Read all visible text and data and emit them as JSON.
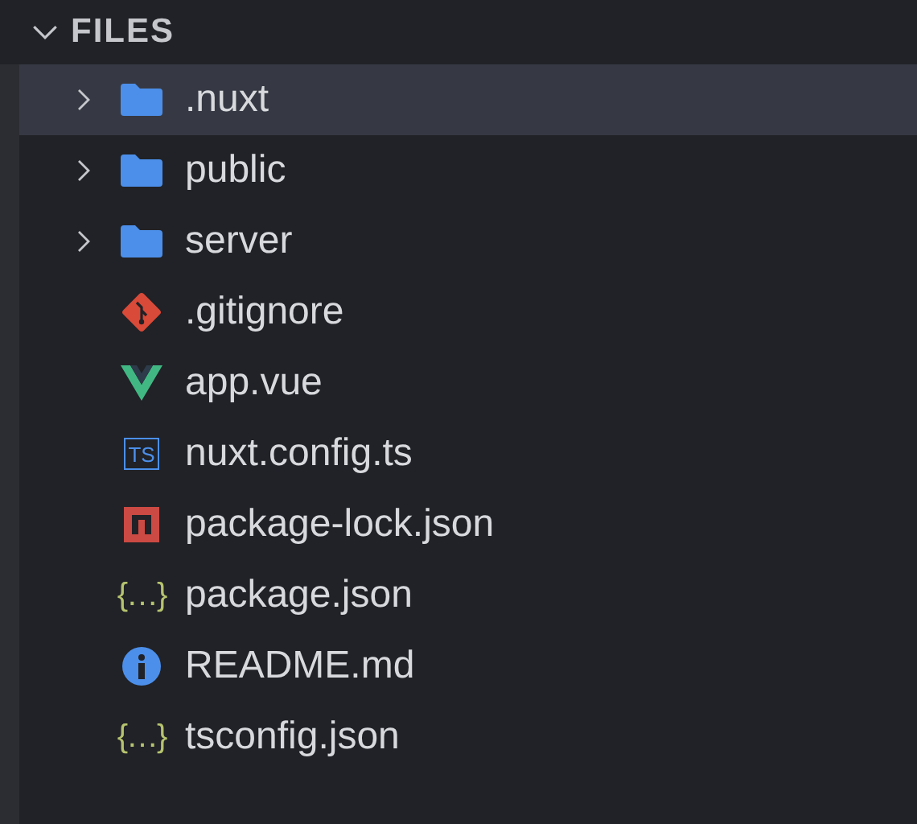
{
  "section": {
    "title": "FILES",
    "expanded": true
  },
  "items": [
    {
      "name": ".nuxt",
      "kind": "folder",
      "expanded": false,
      "selected": true
    },
    {
      "name": "public",
      "kind": "folder",
      "expanded": false,
      "selected": false
    },
    {
      "name": "server",
      "kind": "folder",
      "expanded": false,
      "selected": false
    },
    {
      "name": ".gitignore",
      "kind": "git",
      "selected": false
    },
    {
      "name": "app.vue",
      "kind": "vue",
      "selected": false
    },
    {
      "name": "nuxt.config.ts",
      "kind": "ts",
      "icon_text": "TS",
      "selected": false
    },
    {
      "name": "package-lock.json",
      "kind": "npm",
      "selected": false
    },
    {
      "name": "package.json",
      "kind": "json",
      "icon_text": "{…}",
      "selected": false
    },
    {
      "name": "README.md",
      "kind": "info",
      "selected": false
    },
    {
      "name": "tsconfig.json",
      "kind": "json",
      "icon_text": "{…}",
      "selected": false
    }
  ]
}
